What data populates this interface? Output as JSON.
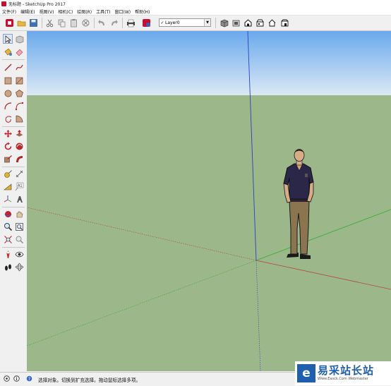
{
  "window": {
    "title": "无标题 - SketchUp Pro 2017"
  },
  "menu": [
    {
      "label": "文件(F)"
    },
    {
      "label": "编辑(E)"
    },
    {
      "label": "视图(V)"
    },
    {
      "label": "相机(C)"
    },
    {
      "label": "绘图(R)"
    },
    {
      "label": "工具(T)"
    },
    {
      "label": "窗口(W)"
    },
    {
      "label": "帮助(H)"
    }
  ],
  "toolbar": {
    "layer_selector": {
      "check": "✓",
      "value": "Layer0",
      "dropdown": "▼"
    }
  },
  "status": {
    "text": "选择对象。切换到扩充选择。拖动鼠标选择多项。"
  },
  "watermark": {
    "title": "易采站长站",
    "url": "Www.Easck.Com  Webmaster",
    "logo_glyph": "e"
  },
  "colors": {
    "sky_top": "#6aa9ec",
    "sky_bottom": "#ddeaf6",
    "ground": "#9cb789",
    "axis_red": "#b5473a",
    "axis_green": "#2fae2f",
    "axis_blue": "#2e3fc8",
    "brand_blue": "#1f5fae"
  }
}
